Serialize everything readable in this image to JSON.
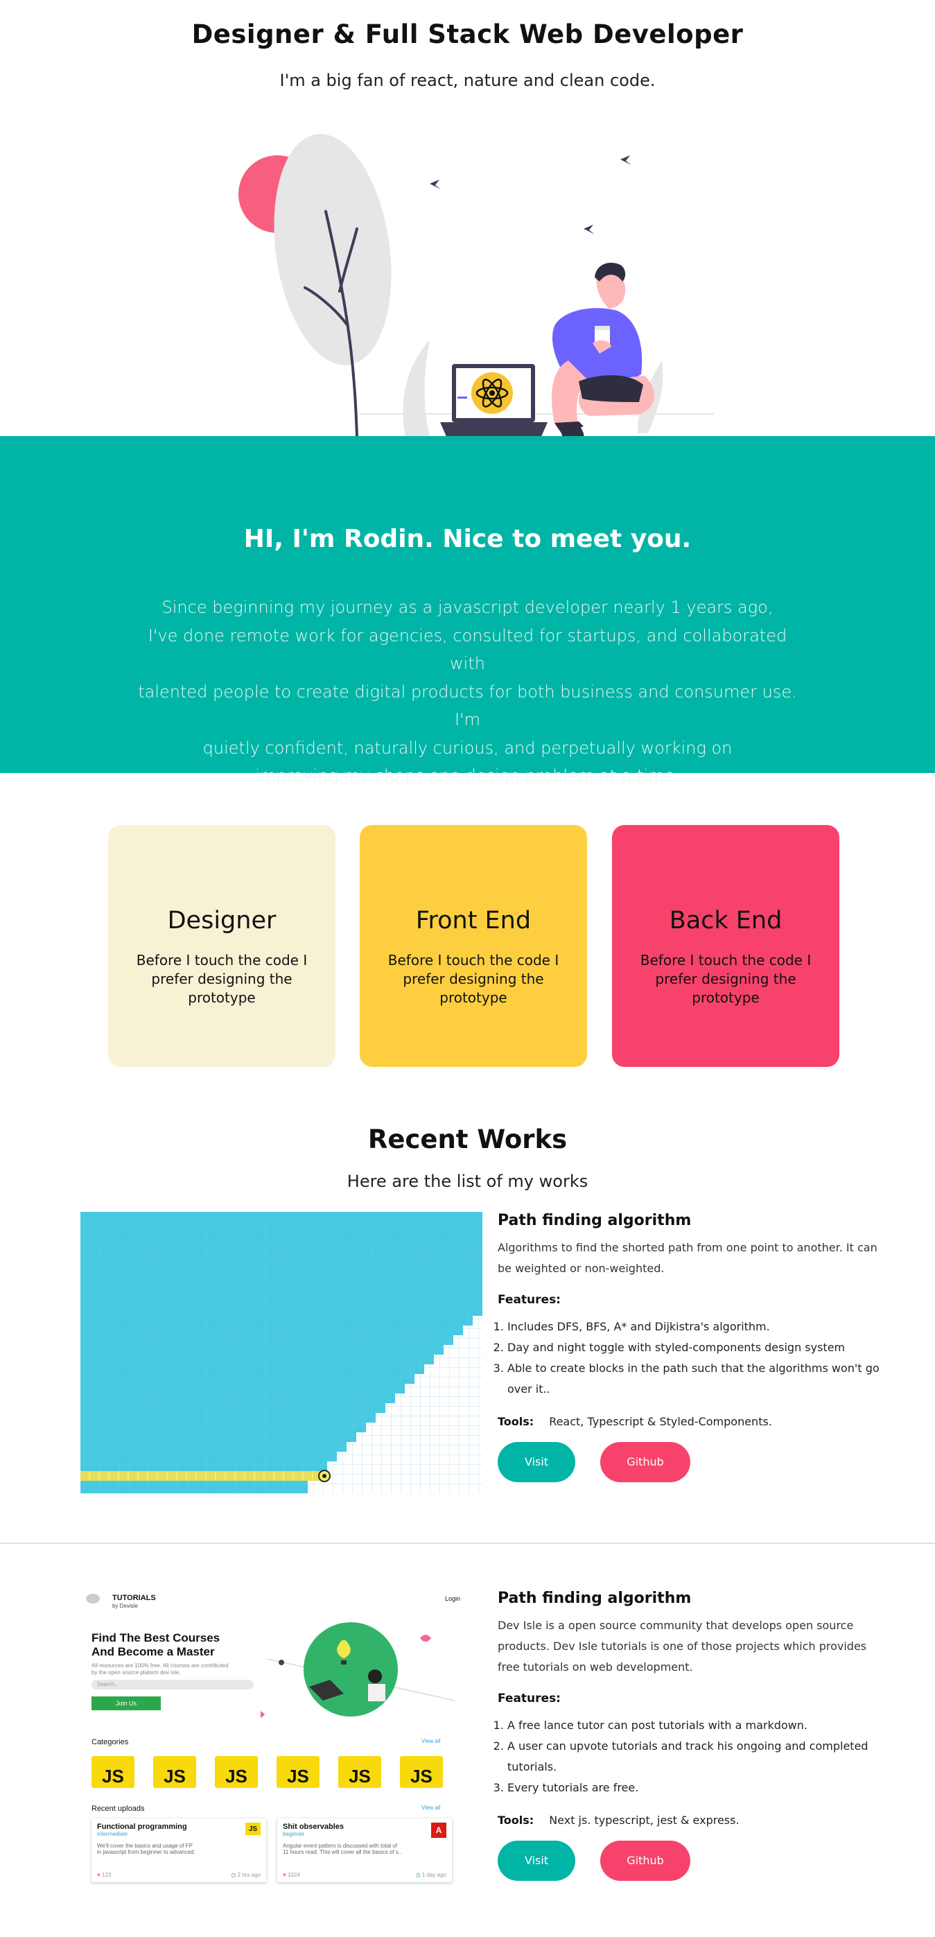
{
  "hero": {
    "title": "Designer & Full Stack Web Developer",
    "subtitle": "I'm a big fan of react, nature and clean code."
  },
  "intro": {
    "heading": "HI, I'm Rodin. Nice to meet you.",
    "lines": [
      "Since beginning my journey as a javascript developer nearly 1 years ago,",
      "I've done remote work for agencies, consulted for startups, and collaborated with",
      "talented people to create digital products for both business and consumer use. I'm",
      "quietly confident, naturally curious, and perpetually working on",
      "improving my chops one design problem at a time."
    ]
  },
  "cards": [
    {
      "title": "Designer",
      "text": "Before I touch the code I prefer designing the prototype",
      "color": "#f8f2d5"
    },
    {
      "title": "Front End",
      "text": "Before I touch the code I prefer designing the prototype",
      "color": "#fdcf40"
    },
    {
      "title": "Back End",
      "text": "Before I touch the code I prefer designing the prototype",
      "color": "#f7426b"
    }
  ],
  "works": {
    "title": "Recent Works",
    "subtitle": "Here are the list of my works"
  },
  "projects": [
    {
      "title": "Path finding algorithm",
      "desc": "Algorithms to find the shorted path from one point to another. It can be weighted or non-weighted.",
      "features_label": "Features:",
      "features": [
        "Includes DFS, BFS, A* and Dijkistra's algorithm.",
        "Day and night toggle with styled-components design system",
        "Able to create blocks in the path such that the algorithms won't go over it.."
      ],
      "tools_label": "Tools:",
      "tools": "React, Typescript & Styled-Components.",
      "visit": "Visit",
      "github": "Github"
    },
    {
      "title": "Path finding algorithm",
      "desc": "Dev Isle is a open source community that develops open source products. Dev Isle tutorials is one of those projects which provides free tutorials on web development.",
      "features_label": "Features:",
      "features": [
        "A free lance tutor can post tutorials with a markdown.",
        "A user can upvote tutorials and track his ongoing and completed tutorials.",
        "Every tutorials are free."
      ],
      "tools_label": "Tools:",
      "tools": "Next js. typescript, jest & express.",
      "visit": "Visit",
      "github": "Github"
    }
  ],
  "tutorial_mock": {
    "brand": "TUTORIALS",
    "brand_sub": "by Devisle",
    "login": "Login",
    "headline_1": "Find The Best Courses",
    "headline_2": "And Become a Master",
    "blurb_1": "All resources are 100% free. All courses are contributed",
    "blurb_2": "by the open source platorm dev isle.",
    "search_placeholder": "Search...",
    "join": "Join Us",
    "categories": "Categories",
    "view_all": "View all",
    "js": "JS",
    "recent": "Recent uploads",
    "card1_title": "Functional programming",
    "card1_level": "intermediate",
    "card1_text_1": "We'll cover the basics and usage of FP",
    "card1_text_2": "in javascript from beginner to advanced.",
    "card1_likes": "123",
    "card1_time": "2 hrs ago",
    "card2_title": "Shit observables",
    "card2_level": "beginner",
    "card2_text_1": "Angular event pattern is discussed with total of",
    "card2_text_2": "11 hours read. This will cover all the basics of s..",
    "card2_likes": "1024",
    "card2_time": "1 day ago"
  }
}
